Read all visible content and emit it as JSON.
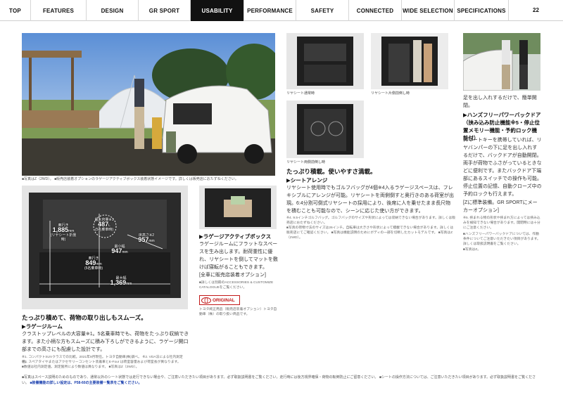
{
  "nav": {
    "items": [
      "TOP",
      "FEATURES",
      "DESIGN",
      "GR SPORT",
      "USABILITY",
      "PERFORMANCE",
      "SAFETY",
      "CONNECTED",
      "WIDE SELECTION",
      "SPECIFICATIONS"
    ],
    "active_index": 4,
    "page_number": "22"
  },
  "photos": {
    "main_caption": "■写真はZ（2WD）。 ■販売店装着オプションのラゲージアクティブボックス装着状態イメージです。詳しくは販売店におたずねください。",
    "seat_normal": "リヤシート通常時",
    "seat_split": "リヤシート片側前倒し時",
    "seat_full": "リヤシート両側前倒し時"
  },
  "luggage": {
    "dims": {
      "length_rear": {
        "label": "奥行き",
        "value": "1,885",
        "unit": "mm",
        "sub": "(リヤシート折畳時)"
      },
      "capacity": {
        "label": "最大容量※1",
        "value": "487",
        "unit": "L",
        "sub": "(5名乗車時)"
      },
      "height": {
        "label": "奥行き",
        "value": "849",
        "unit": "mm",
        "sub": "(5名乗車時)"
      },
      "min_width": {
        "label": "最小幅",
        "value": "947",
        "unit": "mm"
      },
      "floor_height": {
        "label": "床高さ※2",
        "value": "957",
        "unit": "mm"
      },
      "max_width": {
        "label": "最大幅",
        "value": "1,369",
        "unit": "mm"
      }
    },
    "headline": "たっぷり積めて、荷物の取り出しもスムーズ。",
    "subhead": "▶ラゲージルーム",
    "body": "クラストップレベルの大容量※1。5名乗車時でも、荷物をたっぷり収納できます。また小柄な方もスムーズに積み下ろしができるように、ラゲージ開口部までの高さにも配慮した設計です。",
    "notes": [
      "※1. コンパクトSUVクラスでの比較。2021年9月現在。トヨタ自動車(株)調べ。 ※2. VDA法による社内測定値。",
      "※3. スペアタイヤまたはアクセサリーコンセント装着車とE-Four は荷室容量および荷室長が異なります。",
      "■数値は社内測定値。測定箇所により数値は異なります。 ■写真はZ（2WD）。"
    ]
  },
  "active_box": {
    "subhead": "▶ラゲージアクティブボックス",
    "body": "ラゲージルームにフラットなスペースを生み出します。耐荷重性に優れ、リヤシートを倒してマットを敷けば寝転がることもできます。",
    "option_note": "[全車に販売店装着オプション]",
    "small_note": "■詳しくは別冊のACCESSORIES & CUSTOMIZE CATALOGUEをご覧ください。",
    "badge_text": "ORIGINAL",
    "badge_caption": "トヨタ純正用品（販売店装着オプション）トヨタ自動車（株）の取り扱い商品です。"
  },
  "seat": {
    "headline": "たっぷり積載。使いやすさ満載。",
    "subhead": "▶シートアレンジ",
    "body": "リヤシート使用時でもゴルフバッグが4個※4入るラゲージスペースは、フレキシブルにアレンジが可能。リヤシートを両側倒すと奥行きのある荷室が出現。6:4分割可倒式リヤシートの採用により、後席に人を乗せたまま長尺物を積むことも可能なので、シーンに応じた使い方ができます。",
    "notes": [
      "※4. 9.5インチゴルフバッグ。ゴルフバッグのサイズや形状によっては収納できない場合があります。詳しくは販売店におたずねください。",
      "■写真の荷物寸法のサイズは26インチ。自転車は大きさや形状によって積載できない場合があります。詳しくは販売店にてご確認ください。 ■写真は機能説明のためにボディの一部を切断したカットモデルです。 ■写真はZ（2WD）。"
    ]
  },
  "power_door": {
    "intro": "足を出し入れするだけで、簡単開閉。",
    "subhead": "▶ハンズフリーパワーバックドア（挟み込み防止機能※5・停止位置メモリー機能・予約ロック機能付）",
    "body": "スマートキーを携帯していれば、リヤバンパーの下に足を出し入れするだけで、バックドアが自動開閉。両手が荷物でふさがっているときなどに便利です。またバックドア下端部にあるスイッチでの操作も可能。停止位置の記憶、自動クローズ中の予約ロックも行えます。",
    "spec_note": "[Zに標準装備。GR SPORTにメーカーオプション]",
    "notes": [
      "※5. 挟まれる物の形状や挟まれ方によっては挟み込みを検知できない場合があります。開閉時には十分にご注意ください。",
      "■ハンズフリーパワーバックドアについては、作動条件についてご注意いただきたい項目があります。詳しくは取扱説明書をご覧ください。",
      "■写真はZ。"
    ]
  },
  "footer": {
    "text": "■写真はスペース説明のためのものであり、通常以外のシート状態では走行できない場合や、ご注意いただきたい項目があります。必ず取扱説明書をご覧ください。走行時には後方視界確保・荷物の転倒防止にご留意ください。 ■シートの操作方法については、ご注意いただきたい項目があります。必ず取扱説明書をご覧ください。",
    "link": "■装備機能の詳しい設定は、P58-60の主要装備一覧表をご覧ください。"
  }
}
